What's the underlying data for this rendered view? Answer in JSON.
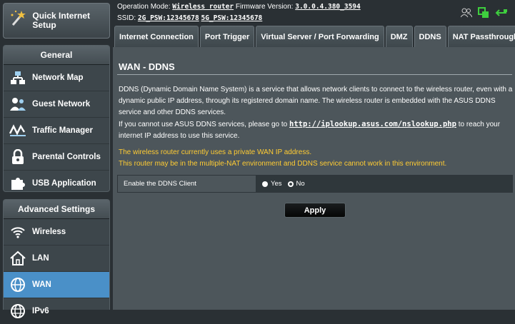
{
  "header": {
    "op_mode_label": "Operation Mode:",
    "op_mode_value": "Wireless router",
    "fw_label": "Firmware Version:",
    "fw_value": "3.0.0.4.380_3594",
    "ssid_label": "SSID:",
    "ssid_2g": "2G_PSW:12345678",
    "ssid_5g": "5G_PSW:12345678",
    "icons": [
      "users-icon",
      "network-status-icon",
      "usb-status-icon"
    ]
  },
  "sidebar": {
    "quick_setup": "Quick Internet Setup",
    "general_title": "General",
    "general_items": [
      {
        "label": "Network Map",
        "icon": "network-map-icon"
      },
      {
        "label": "Guest Network",
        "icon": "guest-network-icon"
      },
      {
        "label": "Traffic Manager",
        "icon": "traffic-manager-icon"
      },
      {
        "label": "Parental Controls",
        "icon": "parental-controls-icon"
      },
      {
        "label": "USB Application",
        "icon": "usb-application-icon"
      }
    ],
    "advanced_title": "Advanced Settings",
    "advanced_items": [
      {
        "label": "Wireless",
        "icon": "wireless-icon"
      },
      {
        "label": "LAN",
        "icon": "lan-icon"
      },
      {
        "label": "WAN",
        "icon": "wan-icon",
        "active": true
      },
      {
        "label": "IPv6",
        "icon": "ipv6-icon"
      }
    ]
  },
  "tabs": [
    {
      "label": "Internet Connection"
    },
    {
      "label": "Port Trigger"
    },
    {
      "label": "Virtual Server / Port Forwarding"
    },
    {
      "label": "DMZ"
    },
    {
      "label": "DDNS",
      "active": true
    },
    {
      "label": "NAT Passthrough"
    }
  ],
  "main": {
    "title": "WAN - DDNS",
    "desc1": "DDNS (Dynamic Domain Name System) is a service that allows network clients to connect to the wireless router, even with a dynamic public IP address, through its registered domain name. The wireless router is embedded with the ASUS DDNS service and other DDNS services.",
    "desc2_pre": "If you cannot use ASUS DDNS services, please go to ",
    "desc2_url": "http://iplookup.asus.com/nslookup.php",
    "desc2_post": " to reach your internet IP address to use this service.",
    "warn1": "The wireless router currently uses a private WAN IP address.",
    "warn2": "This router may be in the multiple-NAT environment and DDNS service cannot work in this environment.",
    "ddns_label": "Enable the DDNS Client",
    "yes_label": "Yes",
    "no_label": "No",
    "ddns_enabled": "No",
    "apply_label": "Apply"
  },
  "colors": {
    "background": "#2a3034",
    "panel": "#4d565b",
    "active_nav": "#4a90c8",
    "warning_text": "#ffcc33",
    "status_green": "#3ecf3e"
  }
}
